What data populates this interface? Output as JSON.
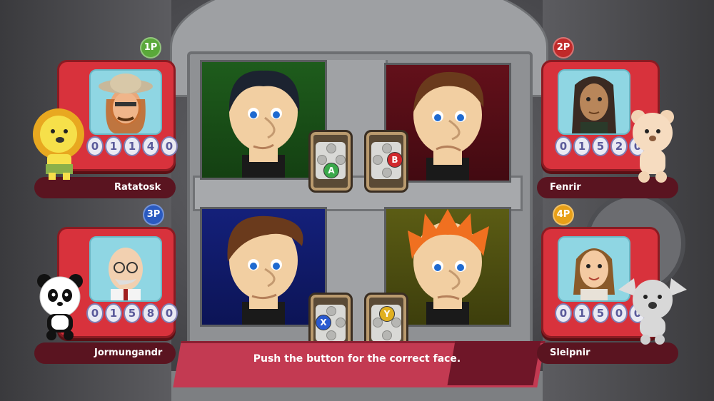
{
  "instruction": "Push the button for the correct face.",
  "colors": {
    "accent_red": "#d8323c",
    "name_bar": "#5a1420",
    "panel_green": "#1e5c1c",
    "panel_red": "#63101a",
    "panel_blue": "#14207a",
    "panel_olive": "#5b5c14"
  },
  "players": [
    {
      "slot": "1P",
      "name": "Ratatosk",
      "score": "01140",
      "badge_color": "#5aa83a",
      "mascot": "lion"
    },
    {
      "slot": "2P",
      "name": "Fenrir",
      "score": "01520",
      "badge_color": "#c02a2a",
      "mascot": "bear"
    },
    {
      "slot": "3P",
      "name": "Jormungandr",
      "score": "01580",
      "badge_color": "#2a5ac0",
      "mascot": "panda"
    },
    {
      "slot": "4P",
      "name": "Sleipnir",
      "score": "01500",
      "badge_color": "#e8a018",
      "mascot": "koala"
    }
  ],
  "buttons": [
    {
      "key": "A",
      "color": "#3aa84a",
      "pos": "bottom"
    },
    {
      "key": "B",
      "color": "#d0282c",
      "pos": "right"
    },
    {
      "key": "X",
      "color": "#2a5ad0",
      "pos": "left"
    },
    {
      "key": "Y",
      "color": "#e0b020",
      "pos": "top"
    }
  ],
  "faces": [
    {
      "panel": "green",
      "hair": "#1c2330"
    },
    {
      "panel": "red",
      "hair": "#6a3a1c"
    },
    {
      "panel": "blue",
      "hair": "#6a3a1c"
    },
    {
      "panel": "olive",
      "hair": "#f07020"
    }
  ]
}
